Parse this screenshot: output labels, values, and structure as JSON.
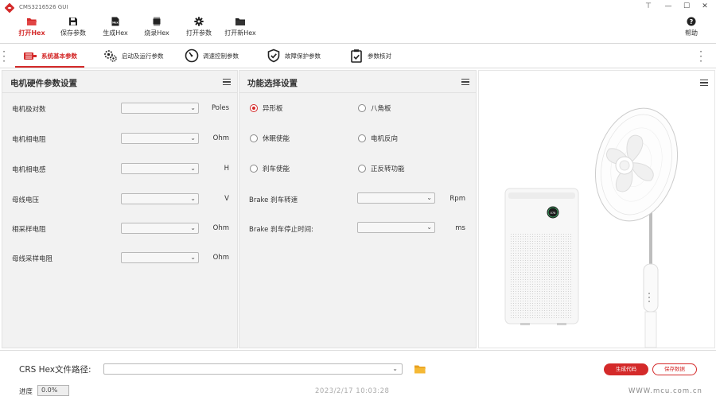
{
  "window": {
    "title": "CMS3216526 GUI",
    "controls": {
      "pin": "⊤",
      "minimize": "—",
      "maximize": "☐",
      "close": "✕"
    }
  },
  "toolbar": {
    "open_hex": "打开Hex",
    "save_params": "保存参数",
    "gen_hex": "生成Hex",
    "burn_hex": "烧录Hex",
    "open_params": "打开参数",
    "open_new_hex": "打开新Hex",
    "help": "帮助",
    "hex_badge": "Hex"
  },
  "tabs": [
    {
      "label": "系统基本参数",
      "icon": "motor-icon",
      "active": true
    },
    {
      "label": "启动及运行参数",
      "icon": "gears-icon",
      "active": false
    },
    {
      "label": "调速控制参数",
      "icon": "dial-icon",
      "active": false
    },
    {
      "label": "故障保护参数",
      "icon": "shield-check-icon",
      "active": false
    },
    {
      "label": "参数核对",
      "icon": "clipboard-check-icon",
      "active": false
    }
  ],
  "motor_panel": {
    "title": "电机硬件参数设置",
    "rows": [
      {
        "label": "电机极对数",
        "value": "",
        "unit": "Poles"
      },
      {
        "label": "电机相电阻",
        "value": "",
        "unit": "Ohm"
      },
      {
        "label": "电机相电感",
        "value": "",
        "unit": "H"
      },
      {
        "label": "母线电压",
        "value": "",
        "unit": "V"
      },
      {
        "label": "相采样电阻",
        "value": "",
        "unit": "Ohm"
      },
      {
        "label": "母线采样电阻",
        "value": "",
        "unit": "Ohm"
      }
    ]
  },
  "function_panel": {
    "title": "功能选择设置",
    "options": [
      {
        "label": "异形板",
        "checked": true
      },
      {
        "label": "八角板",
        "checked": false
      },
      {
        "label": "休眠使能",
        "checked": false
      },
      {
        "label": "电机反向",
        "checked": false
      },
      {
        "label": "刹车使能",
        "checked": false
      },
      {
        "label": "正反转功能",
        "checked": false
      }
    ],
    "fields": [
      {
        "label": "Brake 刹车转速",
        "value": "",
        "unit": "Rpm"
      },
      {
        "label": "Brake 刹车停止时间:",
        "value": "",
        "unit": "ms"
      }
    ]
  },
  "purifier_display": {
    "text": "078"
  },
  "bottom": {
    "path_label": "CRS Hex文件路径:",
    "path_value": "",
    "generate_button": "生成代码",
    "save_button": "保存数据",
    "progress_label": "进度",
    "progress_value": "0.0%",
    "datetime": "2023/2/17  10:03:28",
    "website": "WWW.mcu.com.cn"
  },
  "colors": {
    "accent": "#d42a2a",
    "panel_bg": "#f2f2f2"
  }
}
